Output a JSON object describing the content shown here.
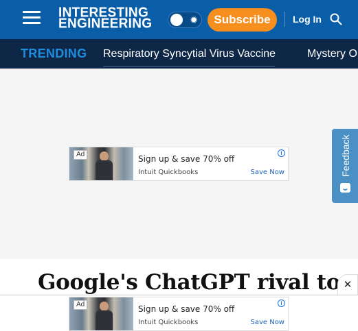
{
  "header": {
    "logo_line1": "INTERESTING",
    "logo_line2": "ENGINEERING",
    "subscribe_label": "Subscribe",
    "login_label": "Log In",
    "theme_toggle_icon": "sun-icon"
  },
  "trending": {
    "label": "TRENDING",
    "items": [
      "Respiratory Syncytial Virus Vaccine",
      "Mystery O"
    ]
  },
  "ads": {
    "badge": "Ad",
    "headline": "Sign up & save 70% off",
    "sponsor": "Intuit Quickbooks",
    "cta": "Save Now",
    "info_icon": "ⓘ"
  },
  "feedback": {
    "label": "Feedback"
  },
  "article": {
    "headline": "Google's ChatGPT rival to"
  },
  "sticky": {
    "close_label": "✕"
  },
  "colors": {
    "header_bg": "#0a5ea8",
    "trending_bg": "#0e2747",
    "trending_label": "#1f8ddd",
    "subscribe_bg": "#f78f1e",
    "feedback_bg": "#4a90c4"
  }
}
